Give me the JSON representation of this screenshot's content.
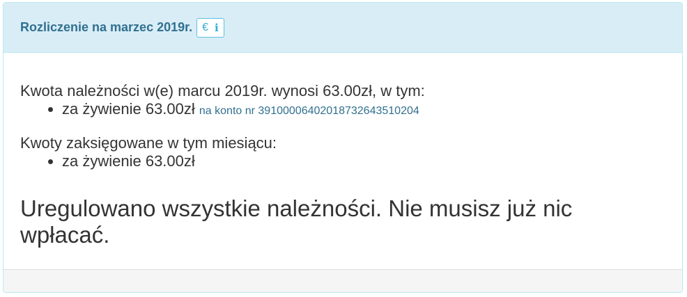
{
  "panel": {
    "title": "Rozliczenie na marzec 2019r.",
    "button": {
      "euro_icon": "€",
      "info_icon": "i"
    }
  },
  "body": {
    "due_text": "Kwota należności w(e) marcu 2019r. wynosi 63.00zł, w tym:",
    "due_items": [
      {
        "label": "za żywienie 63.00zł",
        "account": "na konto nr 39100006402018732643510204"
      }
    ],
    "booked_text": "Kwoty zaksięgowane w tym miesiącu:",
    "booked_items": [
      {
        "label": "za żywienie 63.00zł"
      }
    ],
    "final_message": "Uregulowano wszystkie należności. Nie musisz już nic wpłacać."
  },
  "colors": {
    "heading_bg": "#d9edf7",
    "heading_text": "#31708f",
    "border": "#bce8f1",
    "button_accent": "#5bc0de",
    "text": "#333333",
    "footer_bg": "#f5f5f5"
  }
}
